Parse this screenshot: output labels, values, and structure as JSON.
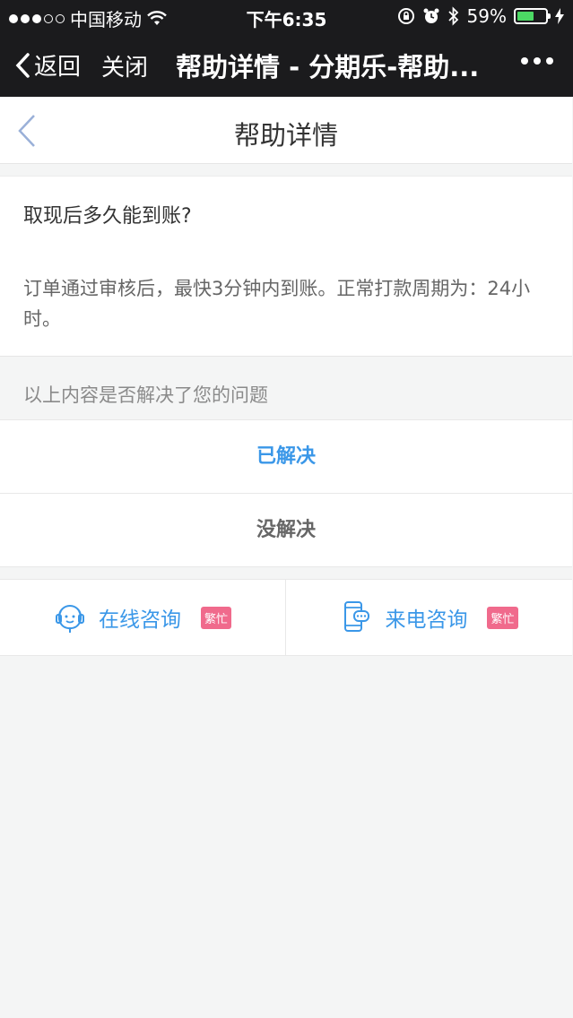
{
  "status_bar": {
    "carrier": "中国移动",
    "time": "下午6:35",
    "battery_percent": "59%",
    "battery_level": 0.59,
    "icons": [
      "signal-icon",
      "wifi-icon",
      "rotation-lock-icon",
      "alarm-icon",
      "bluetooth-icon",
      "battery-icon",
      "charging-icon"
    ]
  },
  "nav_bar": {
    "back_label": "返回",
    "close_label": "关闭",
    "title": "帮助详情 - 分期乐-帮助...",
    "more_icon": "more-icon"
  },
  "page": {
    "title": "帮助详情"
  },
  "faq": {
    "question": "取现后多久能到账?",
    "answer": "订单通过审核后，最快3分钟内到账。正常打款周期为：24小时。"
  },
  "feedback": {
    "prompt": "以上内容是否解决了您的问题",
    "resolved_label": "已解决",
    "unresolved_label": "没解决"
  },
  "consult": {
    "online_label": "在线咨询",
    "online_badge": "繁忙",
    "phone_label": "来电咨询",
    "phone_badge": "繁忙"
  },
  "colors": {
    "accent": "#3a97e8",
    "badge": "#f06a8c",
    "nav_bg": "#1b1b1d",
    "page_bg": "#f4f5f5"
  }
}
